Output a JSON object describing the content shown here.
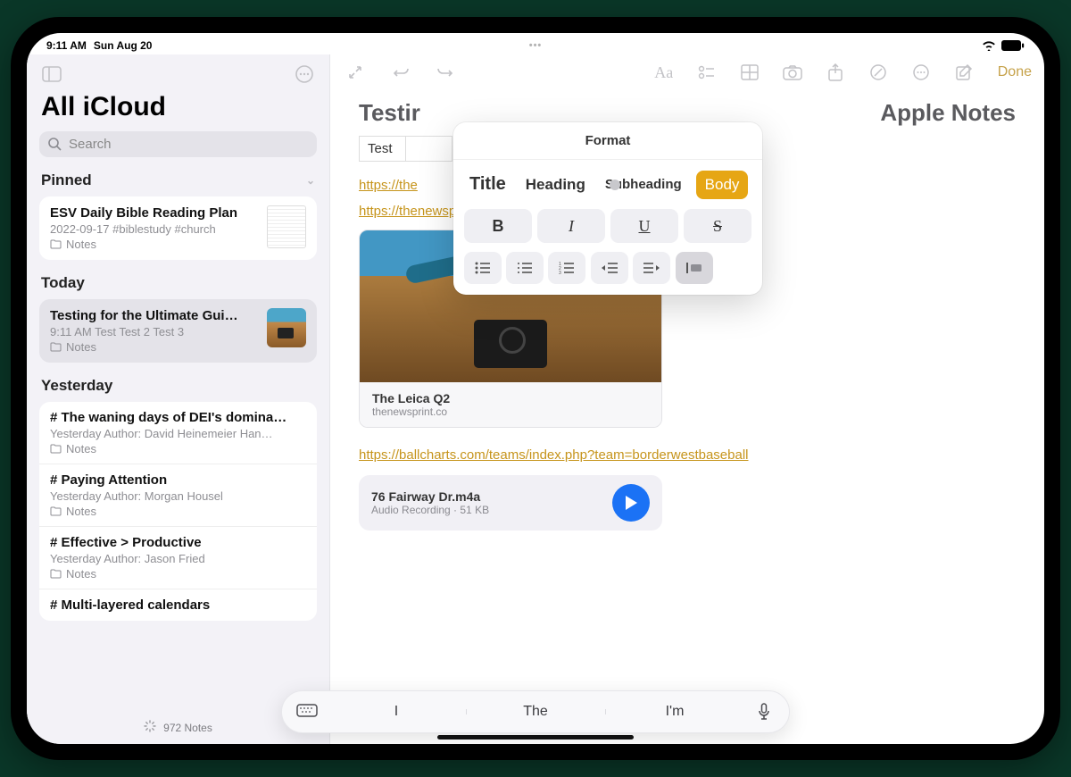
{
  "status": {
    "time": "9:11 AM",
    "date": "Sun Aug 20"
  },
  "sidebar": {
    "title": "All iCloud",
    "search_placeholder": "Search",
    "sections": {
      "pinned": "Pinned",
      "today": "Today",
      "yesterday": "Yesterday"
    },
    "pinned_note": {
      "title": "ESV Daily Bible Reading Plan",
      "subtitle": "2022-09-17  #biblestudy #church",
      "folder": "Notes"
    },
    "today_note": {
      "title": "Testing for the Ultimate Gui…",
      "subtitle": "9:11 AM  Test Test 2 Test 3",
      "folder": "Notes"
    },
    "yesterday_notes": [
      {
        "title": "# The waning days of DEI's domina…",
        "subtitle": "Yesterday  Author: David Heinemeier Han…",
        "folder": "Notes"
      },
      {
        "title": "# Paying Attention",
        "subtitle": "Yesterday  Author: Morgan Housel",
        "folder": "Notes"
      },
      {
        "title": "# Effective > Productive",
        "subtitle": "Yesterday  Author: Jason Fried",
        "folder": "Notes"
      },
      {
        "title": "# Multi-layered calendars",
        "subtitle": "",
        "folder": ""
      }
    ],
    "footer_count": "972 Notes"
  },
  "format_popover": {
    "title": "Format",
    "styles": {
      "title": "Title",
      "heading": "Heading",
      "subheading": "Subheading",
      "body": "Body"
    }
  },
  "editor": {
    "done": "Done",
    "title_left": "Testir",
    "title_right": "Apple Notes",
    "table_cell_1": "Test",
    "link1_visible": "https://the",
    "link2": "https://thenewsprint.co/2023/08/13/the-leica-q2/",
    "link_card": {
      "title": "The Leica Q2",
      "source": "thenewsprint.co"
    },
    "link3": "https://ballcharts.com/teams/index.php?team=borderwestbaseball",
    "audio": {
      "title": "76 Fairway Dr.m4a",
      "subtitle": "Audio Recording · 51 KB"
    }
  },
  "keyboard": {
    "suggestions": [
      "I",
      "The",
      "I'm"
    ]
  }
}
